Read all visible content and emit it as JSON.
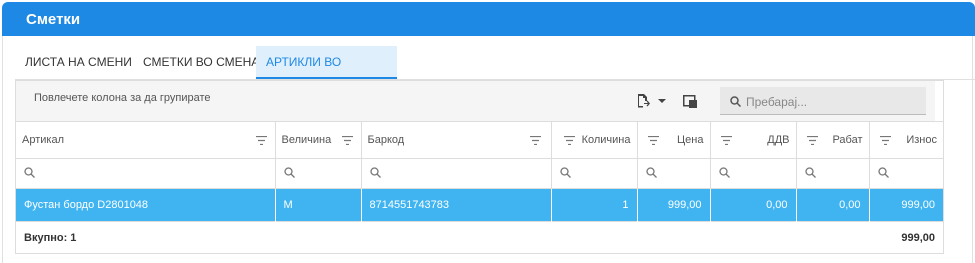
{
  "window": {
    "title": "Сметки"
  },
  "tabs": [
    {
      "label": "ЛИСТА НА СМЕНИ",
      "active": false
    },
    {
      "label": "СМЕТКИ ВО СМЕНА",
      "active": false
    },
    {
      "label": "АРТИКЛИ ВО СМЕТКА",
      "active": true
    }
  ],
  "toolbar": {
    "group_hint": "Повлечете колона за да групирате",
    "export_icon": "export-icon",
    "dropdown_icon": "caret-down-icon",
    "column_chooser_icon": "column-chooser-icon",
    "search_placeholder": "Пребарај..."
  },
  "columns": [
    "Артикал",
    "Величина",
    "Баркод",
    "Количина",
    "Цена",
    "ДДВ",
    "Рабат",
    "Износ"
  ],
  "rows": [
    {
      "artikal": "Фустан бордо D2801048",
      "velicina": "M",
      "barkod": "8714551743783",
      "kolicina": "1",
      "cena": "999,00",
      "ddv": "0,00",
      "rabat": "0,00",
      "iznos": "999,00"
    }
  ],
  "summary": {
    "count_label": "Вкупно: 1",
    "total": "999,00"
  },
  "colors": {
    "header": "#1e88e5",
    "selected_row": "#40b4f1",
    "active_tab_bg": "#dff0fc"
  }
}
